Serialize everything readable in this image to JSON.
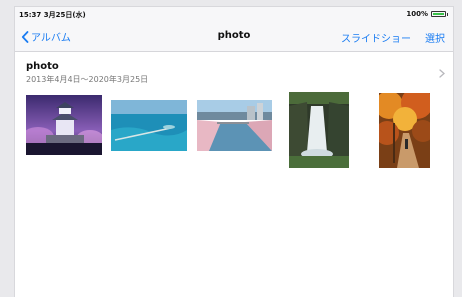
{
  "status": {
    "time_date": "15:37  3月25日(水)",
    "battery_percent": "100%",
    "battery_level": 1.0
  },
  "nav": {
    "back_label": "アルバム",
    "title": "photo",
    "slideshow_label": "スライドショー",
    "select_label": "選択"
  },
  "album": {
    "title": "photo",
    "date_range": "2013年4月4日～2020年3月25日"
  },
  "photos": [
    {
      "subject": "castle at night"
    },
    {
      "subject": "turquoise sea with pier"
    },
    {
      "subject": "river with cherry blossoms"
    },
    {
      "subject": "waterfall"
    },
    {
      "subject": "autumn forest path"
    }
  ],
  "colors": {
    "accent": "#1a7cf2",
    "battery": "#39c24a"
  }
}
